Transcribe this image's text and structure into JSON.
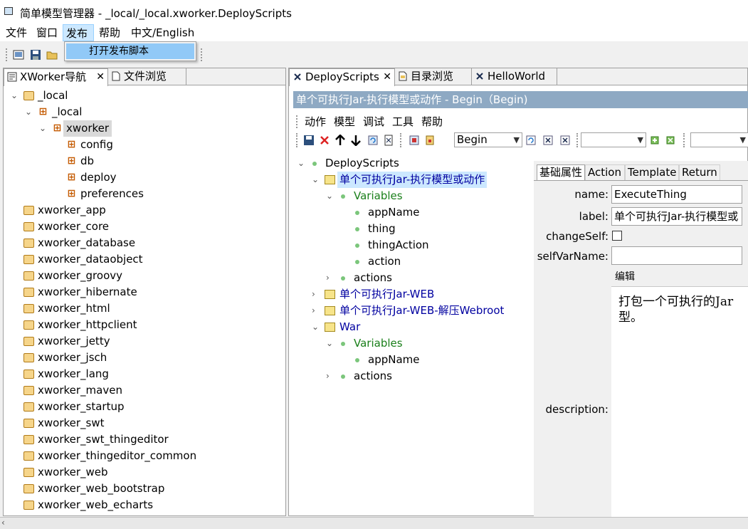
{
  "window": {
    "title": "简单模型管理器 - _local/_local.xworker.DeployScripts"
  },
  "menubar": {
    "items": [
      "文件",
      "窗口",
      "发布",
      "帮助",
      "中文/English"
    ],
    "active_index": 2
  },
  "dropdown": {
    "items": [
      "打开发布脚本"
    ]
  },
  "left_tabs": [
    {
      "label": "XWorker导航"
    },
    {
      "label": "文件浏览"
    }
  ],
  "nav_tree": [
    {
      "label": "_local",
      "depth": 0,
      "expanded": true,
      "icon": "package-icon"
    },
    {
      "label": "_local",
      "depth": 1,
      "expanded": true,
      "icon": "category-icon"
    },
    {
      "label": "xworker",
      "depth": 2,
      "expanded": true,
      "icon": "category-icon",
      "selected": true
    },
    {
      "label": "config",
      "depth": 3,
      "icon": "category-icon"
    },
    {
      "label": "db",
      "depth": 3,
      "icon": "category-icon"
    },
    {
      "label": "deploy",
      "depth": 3,
      "icon": "category-icon"
    },
    {
      "label": "preferences",
      "depth": 3,
      "icon": "category-icon"
    },
    {
      "label": "xworker_app",
      "depth": 0,
      "icon": "package-icon"
    },
    {
      "label": "xworker_core",
      "depth": 0,
      "icon": "package-icon"
    },
    {
      "label": "xworker_database",
      "depth": 0,
      "icon": "package-icon"
    },
    {
      "label": "xworker_dataobject",
      "depth": 0,
      "icon": "package-icon"
    },
    {
      "label": "xworker_groovy",
      "depth": 0,
      "icon": "package-icon"
    },
    {
      "label": "xworker_hibernate",
      "depth": 0,
      "icon": "package-icon"
    },
    {
      "label": "xworker_html",
      "depth": 0,
      "icon": "package-icon"
    },
    {
      "label": "xworker_httpclient",
      "depth": 0,
      "icon": "package-icon"
    },
    {
      "label": "xworker_jetty",
      "depth": 0,
      "icon": "package-icon"
    },
    {
      "label": "xworker_jsch",
      "depth": 0,
      "icon": "package-icon"
    },
    {
      "label": "xworker_lang",
      "depth": 0,
      "icon": "package-icon"
    },
    {
      "label": "xworker_maven",
      "depth": 0,
      "icon": "package-icon"
    },
    {
      "label": "xworker_startup",
      "depth": 0,
      "icon": "package-icon"
    },
    {
      "label": "xworker_swt",
      "depth": 0,
      "icon": "package-icon"
    },
    {
      "label": "xworker_swt_thingeditor",
      "depth": 0,
      "icon": "package-icon"
    },
    {
      "label": "xworker_thingeditor_common",
      "depth": 0,
      "icon": "package-icon"
    },
    {
      "label": "xworker_web",
      "depth": 0,
      "icon": "package-icon"
    },
    {
      "label": "xworker_web_bootstrap",
      "depth": 0,
      "icon": "package-icon"
    },
    {
      "label": "xworker_web_echarts",
      "depth": 0,
      "icon": "package-icon"
    }
  ],
  "right_tabs": [
    {
      "label": "DeployScripts"
    },
    {
      "label": "目录浏览"
    },
    {
      "label": "HelloWorld"
    }
  ],
  "editor": {
    "header": "单个可执行Jar-执行模型或动作 - Begin（Begin)",
    "menu": [
      "动作",
      "模型",
      "调试",
      "工具",
      "帮助"
    ],
    "combo_value": "Begin"
  },
  "thing_tree": [
    {
      "label": "DeployScripts",
      "depth": 0,
      "expanded": true,
      "icon": "dot",
      "color": "#000000"
    },
    {
      "label": "单个可执行Jar-执行模型或动作",
      "depth": 1,
      "expanded": true,
      "icon": "arrow",
      "color": "#0000a0",
      "selected": true
    },
    {
      "label": "Variables",
      "depth": 2,
      "expanded": true,
      "icon": "dot",
      "color": "#1a7f1a"
    },
    {
      "label": "appName",
      "depth": 3,
      "icon": "dot",
      "color": "#000000"
    },
    {
      "label": "thing",
      "depth": 3,
      "icon": "dot",
      "color": "#000000"
    },
    {
      "label": "thingAction",
      "depth": 3,
      "icon": "dot",
      "color": "#000000"
    },
    {
      "label": "action",
      "depth": 3,
      "icon": "dot",
      "color": "#000000"
    },
    {
      "label": "actions",
      "depth": 2,
      "expanded": false,
      "icon": "dot",
      "color": "#000000"
    },
    {
      "label": "单个可执行Jar-WEB",
      "depth": 1,
      "expanded": false,
      "icon": "arrow",
      "color": "#0000a0"
    },
    {
      "label": "单个可执行Jar-WEB-解压Webroot",
      "depth": 1,
      "expanded": false,
      "icon": "arrow",
      "color": "#0000a0"
    },
    {
      "label": "War",
      "depth": 1,
      "expanded": true,
      "icon": "arrow",
      "color": "#0000a0"
    },
    {
      "label": "Variables",
      "depth": 2,
      "expanded": true,
      "icon": "dot",
      "color": "#1a7f1a"
    },
    {
      "label": "appName",
      "depth": 3,
      "icon": "dot",
      "color": "#000000"
    },
    {
      "label": "actions",
      "depth": 2,
      "expanded": false,
      "icon": "dot",
      "color": "#000000"
    }
  ],
  "props": {
    "tabs": [
      "基础属性",
      "Action",
      "Template",
      "Return"
    ],
    "name_label": "name:",
    "name_value": "ExecuteThing",
    "label_label": "label:",
    "label_value": "单个可执行Jar-执行模型或",
    "changeSelf_label": "changeSelf:",
    "selfVarName_label": "selfVarName:",
    "edit_label": "编辑",
    "description_label": "description:",
    "description_text": "打包一个可执行的Jar\n型。"
  }
}
